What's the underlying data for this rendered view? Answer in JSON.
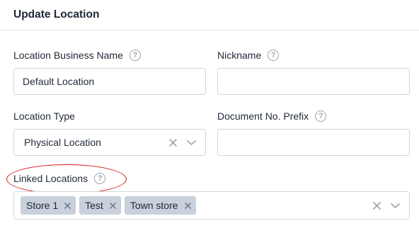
{
  "dialog": {
    "title": "Update Location"
  },
  "fields": {
    "business_name": {
      "label": "Location Business Name",
      "value": "Default Location"
    },
    "nickname": {
      "label": "Nickname",
      "value": ""
    },
    "location_type": {
      "label": "Location Type",
      "value": "Physical Location"
    },
    "doc_prefix": {
      "label": "Document No. Prefix",
      "value": ""
    },
    "linked_locations": {
      "label": "Linked Locations",
      "chips": [
        "Store 1",
        "Test",
        "Town store"
      ]
    }
  },
  "icons": {
    "help": "?",
    "clear": "x-icon",
    "dropdown": "chevron-down-icon"
  },
  "colors": {
    "annotation_circle": "#d81c1c",
    "chip_bg": "#c8d1dc"
  }
}
